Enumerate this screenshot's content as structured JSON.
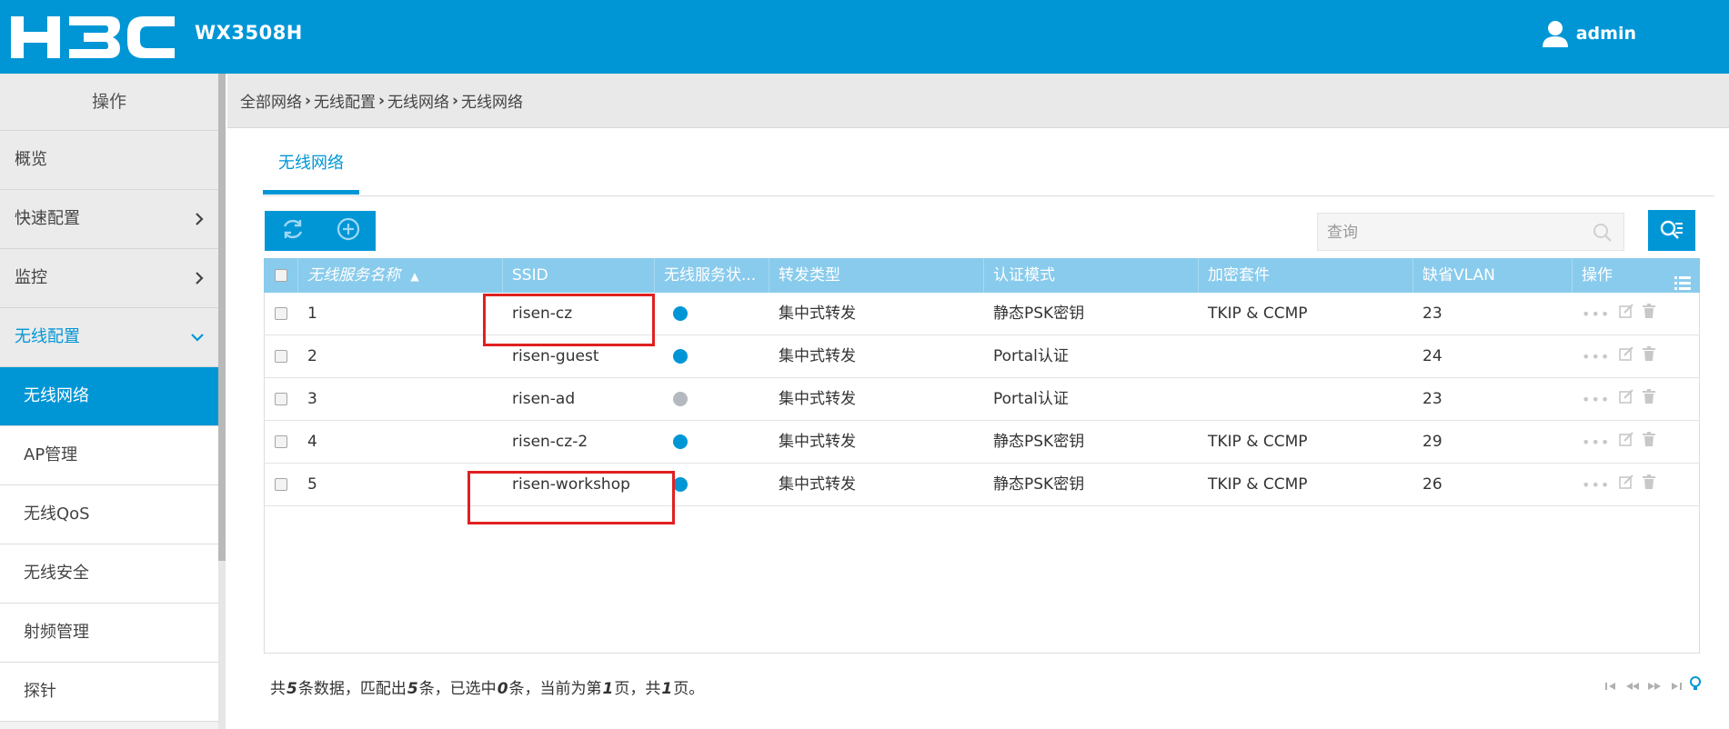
{
  "header": {
    "logo_text": "H3C",
    "model": "WX3508H",
    "user": "admin"
  },
  "sidebar": {
    "heading": "操作",
    "items": [
      {
        "label": "概览"
      },
      {
        "label": "快速配置"
      },
      {
        "label": "监控"
      },
      {
        "label": "无线配置"
      }
    ],
    "subitems": [
      {
        "label": "无线网络"
      },
      {
        "label": "AP管理"
      },
      {
        "label": "无线QoS"
      },
      {
        "label": "无线安全"
      },
      {
        "label": "射频管理"
      },
      {
        "label": "探针"
      }
    ]
  },
  "breadcrumb": [
    "全部网络",
    "无线配置",
    "无线网络",
    "无线网络"
  ],
  "tab": {
    "label": "无线网络"
  },
  "search": {
    "placeholder": "查询"
  },
  "table": {
    "columns": [
      "无线服务名称",
      "SSID",
      "无线服务状...",
      "转发类型",
      "认证模式",
      "加密套件",
      "缺省VLAN",
      "操作"
    ],
    "rows": [
      {
        "name": "1",
        "ssid": "risen-cz",
        "status": "enabled",
        "forward": "集中式转发",
        "auth": "静态PSK密钥",
        "cipher": "TKIP & CCMP",
        "vlan": "23"
      },
      {
        "name": "2",
        "ssid": "risen-guest",
        "status": "enabled",
        "forward": "集中式转发",
        "auth": "Portal认证",
        "cipher": "",
        "vlan": "24"
      },
      {
        "name": "3",
        "ssid": "risen-ad",
        "status": "disabled",
        "forward": "集中式转发",
        "auth": "Portal认证",
        "cipher": "",
        "vlan": "23"
      },
      {
        "name": "4",
        "ssid": "risen-cz-2",
        "status": "enabled",
        "forward": "集中式转发",
        "auth": "静态PSK密钥",
        "cipher": "TKIP & CCMP",
        "vlan": "29"
      },
      {
        "name": "5",
        "ssid": "risen-workshop",
        "status": "enabled",
        "forward": "集中式转发",
        "auth": "静态PSK密钥",
        "cipher": "TKIP & CCMP",
        "vlan": "26"
      }
    ]
  },
  "footer": {
    "p1": "共",
    "total": "5",
    "p2": "条数据，匹配出",
    "matched": "5",
    "p3": "条，已选中",
    "selected": "0",
    "p4": "条，当前为第",
    "page": "1",
    "p5": "页，共",
    "pages": "1",
    "p6": "页。"
  },
  "colors": {
    "brand": "#0096d6",
    "table_header": "#89cbec",
    "status_on": "#0096d6",
    "status_off": "#b3b9bf",
    "highlight": "#e02020"
  }
}
